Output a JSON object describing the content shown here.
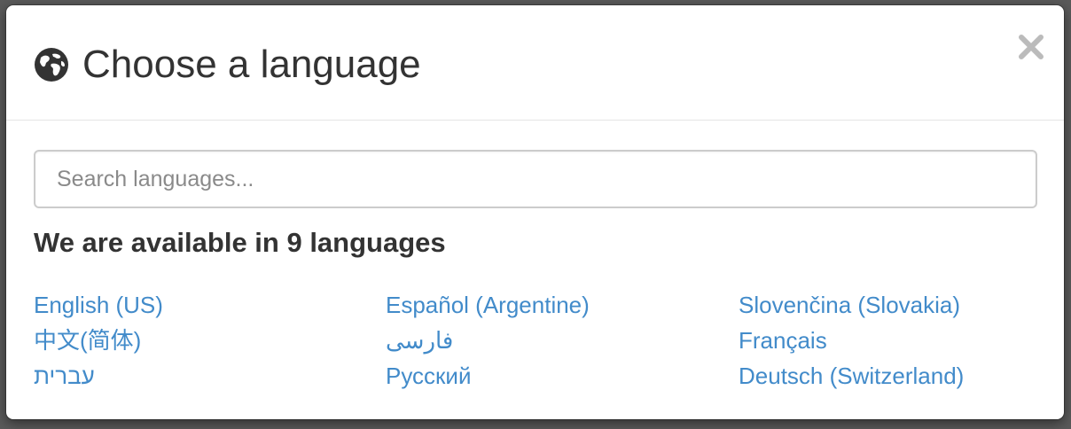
{
  "header": {
    "title": "Choose a language",
    "icon": "globe-icon",
    "close_label": "×"
  },
  "search": {
    "placeholder": "Search languages...",
    "value": ""
  },
  "available_heading": "We are available in 9 languages",
  "languages": {
    "columns": [
      [
        "English (US)",
        "中文(简体)",
        "עברית"
      ],
      [
        "Español (Argentine)",
        "فارسی",
        "Русский"
      ],
      [
        "Slovenčina (Slovakia)",
        "Français",
        "Deutsch (Switzerland)"
      ]
    ]
  },
  "colors": {
    "link": "#428bca",
    "title": "#333333",
    "close": "#bbbbbb"
  }
}
